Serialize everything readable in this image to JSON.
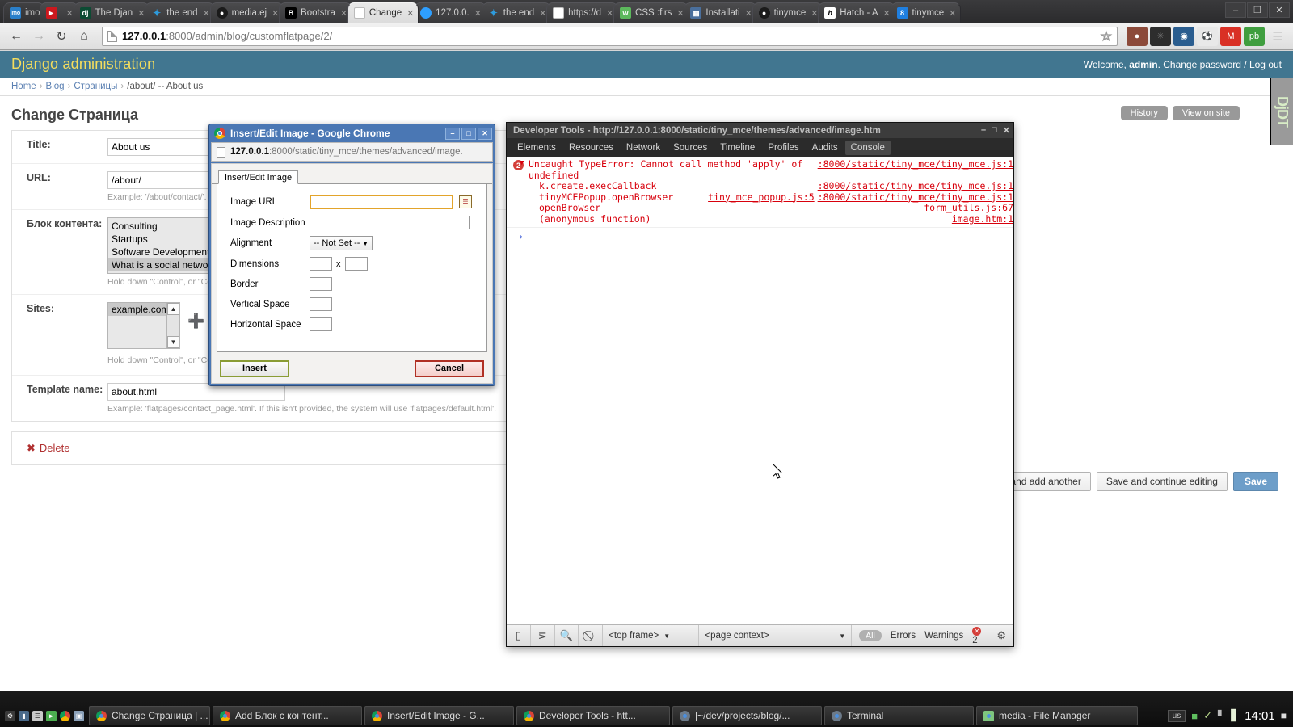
{
  "browser": {
    "tabs": [
      {
        "label": "imo",
        "favicon": "imo-icon",
        "color": "#3a3a3c",
        "first": true
      },
      {
        "label": "",
        "favicon": "youtube-icon",
        "color": "#cc181e"
      },
      {
        "label": "The Djan",
        "favicon": "django-icon",
        "color": "#0c4b33"
      },
      {
        "label": "the end",
        "favicon": "dropbox-icon",
        "color": "#1e88e5"
      },
      {
        "label": "media.ej",
        "favicon": "github-icon",
        "color": "#222222"
      },
      {
        "label": "Bootstra",
        "favicon": "bootstrap-icon",
        "color": "#000000"
      },
      {
        "label": "Change",
        "favicon": "page-icon",
        "color": "#ffffff",
        "active": true
      },
      {
        "label": "127.0.0.",
        "favicon": "disqus-icon",
        "color": "#2e9fff"
      },
      {
        "label": "the end",
        "favicon": "dropbox-icon",
        "color": "#1e88e5"
      },
      {
        "label": "https://d",
        "favicon": "page-icon",
        "color": "#ffffff"
      },
      {
        "label": "CSS :firs",
        "favicon": "w3c-icon",
        "color": "#5cb85c"
      },
      {
        "label": "Installati",
        "favicon": "docs-icon",
        "color": "#4a6f9c"
      },
      {
        "label": "tinymce",
        "favicon": "github-icon",
        "color": "#222222"
      },
      {
        "label": "Hatch - A",
        "favicon": "hatch-icon",
        "color": "#ffffff"
      },
      {
        "label": "tinymce",
        "favicon": "blue-b-icon",
        "color": "#1f7fe0"
      }
    ],
    "window_controls": [
      "minimize",
      "maximize",
      "close"
    ],
    "nav": {
      "back": "back-arrow",
      "forward": "forward-arrow",
      "reload": "reload-icon",
      "home": "home-icon"
    },
    "url_host": "127.0.0.1",
    "url_rest": ":8000/admin/blog/customflatpage/2/",
    "bookmark": "star-icon",
    "extensions": [
      "pocket-icon",
      "gear-icon",
      "camera-icon",
      "football-icon",
      "gmail-icon",
      "photobucket-icon",
      "menu-icon"
    ]
  },
  "django": {
    "branding": "Django administration",
    "welcome_prefix": "Welcome, ",
    "welcome_user": "admin",
    "welcome_suffix": ". Change password / Log out",
    "breadcrumbs": [
      "Home",
      "Blog",
      "Страницы",
      "/about/ -- About us"
    ],
    "page_title": "Change Страница",
    "object_tools": [
      "History",
      "View on site"
    ],
    "djdt_label": "DjDT",
    "fields": {
      "title": {
        "label": "Title:",
        "value": "About us"
      },
      "url": {
        "label": "URL:",
        "value": "/about/",
        "help": "Example: '/about/contact/'."
      },
      "content_block": {
        "label": "Блок контента:",
        "options": [
          "Consulting",
          "Startups",
          "Software Development",
          "What is a social network"
        ],
        "selected": [
          "What is a social network"
        ],
        "help": "Hold down \"Control\", or \"Co"
      },
      "sites": {
        "label": "Sites:",
        "options": [
          "example.com"
        ],
        "selected": [
          "example.com"
        ],
        "help": "Hold down \"Control\", or \"Co",
        "add_icon": "plus-icon"
      },
      "template_name": {
        "label": "Template name:",
        "value": "about.html",
        "help": "Example: 'flatpages/contact_page.html'. If this isn't provided, the system will use 'flatpages/default.html'."
      }
    },
    "delete_link": "Delete",
    "delete_icon": "delete-x-icon",
    "submit_row": {
      "add_another": "Save and add another",
      "continue": "Save and continue editing",
      "save": "Save"
    }
  },
  "dialog": {
    "window_title": "Insert/Edit Image - Google Chrome",
    "app_icon": "chrome-icon",
    "window_controls": [
      "minimize",
      "maximize",
      "close"
    ],
    "url_host": "127.0.0.1",
    "url_rest": ":8000/static/tiny_mce/themes/advanced/image.",
    "tab_label": "Insert/Edit Image",
    "fields": [
      {
        "label": "Image URL",
        "value": "",
        "kind": "text-browse",
        "browse_icon": "browse-list-icon"
      },
      {
        "label": "Image Description",
        "value": "",
        "kind": "text"
      },
      {
        "label": "Alignment",
        "value": "-- Not Set --",
        "kind": "select"
      },
      {
        "label": "Dimensions",
        "value": "",
        "value2": "",
        "separator": "x",
        "kind": "dims"
      },
      {
        "label": "Border",
        "value": "",
        "kind": "small"
      },
      {
        "label": "Vertical Space",
        "value": "",
        "kind": "small"
      },
      {
        "label": "Horizontal Space",
        "value": "",
        "kind": "small"
      }
    ],
    "insert_button": "Insert",
    "cancel_button": "Cancel"
  },
  "devtools": {
    "title": "Developer Tools - http://127.0.0.1:8000/static/tiny_mce/themes/advanced/image.htm",
    "window_controls": [
      "minimize",
      "maximize",
      "close"
    ],
    "tabs": [
      "Elements",
      "Resources",
      "Network",
      "Sources",
      "Timeline",
      "Profiles",
      "Audits",
      "Console"
    ],
    "selected_tab": "Console",
    "error_count": "2",
    "console": {
      "message": "Uncaught TypeError: Cannot call method 'apply' of undefined",
      "message_source": ":8000/static/tiny_mce/tiny_mce.js:1",
      "stack": [
        {
          "fn": "k.create.execCallback",
          "mid": "",
          "src": ":8000/static/tiny_mce/tiny_mce.js:1"
        },
        {
          "fn": "tinyMCEPopup.openBrowser",
          "mid": "tiny_mce_popup.js:5",
          "src": ":8000/static/tiny_mce/tiny_mce.js:1"
        },
        {
          "fn": "openBrowser",
          "mid": "",
          "src": "form_utils.js:67"
        },
        {
          "fn": "(anonymous function)",
          "mid": "",
          "src": "image.htm:1"
        }
      ],
      "prompt_symbol": "›"
    },
    "footer": {
      "dock_icon": "dock-icon",
      "console_icon": "console-drawer-icon",
      "search_icon": "search-icon",
      "clear_icon": "clear-icon",
      "frame_selector": "<top frame>",
      "context_selector": "<page context>",
      "filter_all": "All",
      "filter_errors": "Errors",
      "filter_warnings": "Warnings",
      "error_count": "2",
      "settings_icon": "gear-icon"
    }
  },
  "taskbar": {
    "tray_icons": [
      "settings-icon",
      "terminal-icon",
      "note-icon",
      "player-icon",
      "chrome-icon",
      "archive-icon"
    ],
    "tasks": [
      {
        "label": "Change Страница | ...",
        "icon": "chrome-icon"
      },
      {
        "label": "Add Блок с контент...",
        "icon": "chrome-icon"
      },
      {
        "label": "Insert/Edit Image - G...",
        "icon": "chrome-icon"
      },
      {
        "label": "Developer Tools - htt...",
        "icon": "chrome-icon"
      },
      {
        "label": "|~/dev/projects/blog/...",
        "icon": "terminal-icon"
      },
      {
        "label": "Terminal",
        "icon": "terminal-icon"
      },
      {
        "label": "media - File Manager",
        "icon": "folder-icon"
      }
    ],
    "keyboard_layout": "us",
    "status_icons": [
      "battery-icon",
      "shield-icon",
      "network-icon",
      "volume-icon"
    ],
    "clock": "14:01"
  }
}
